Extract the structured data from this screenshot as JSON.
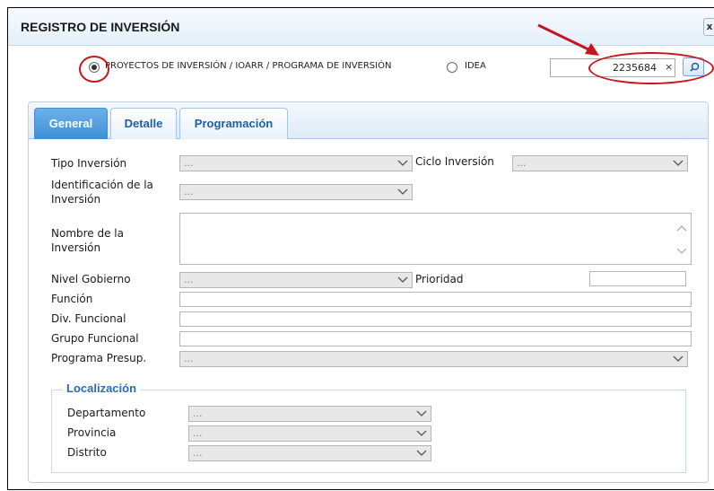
{
  "header": {
    "title": "REGISTRO DE INVERSIÓN"
  },
  "radios": [
    {
      "label": "PROYECTOS DE INVERSIÓN / IOARR / PROGRAMA DE INVERSIÓN",
      "checked": true
    },
    {
      "label": "IDEA",
      "checked": false
    }
  ],
  "search": {
    "value": "2235684",
    "clear": "×"
  },
  "tabs": [
    {
      "label": "General",
      "active": true
    },
    {
      "label": "Detalle",
      "active": false
    },
    {
      "label": "Programación",
      "active": false
    }
  ],
  "form": {
    "tipo_inversion": {
      "label": "Tipo Inversión",
      "value": "..."
    },
    "ciclo_inversion": {
      "label": "Ciclo Inversión",
      "value": "..."
    },
    "identificacion": {
      "label": "Identificación de la Inversión",
      "value": "..."
    },
    "nombre": {
      "label": "Nombre de la Inversión",
      "value": ""
    },
    "nivel_gobierno": {
      "label": "Nivel Gobierno",
      "value": "..."
    },
    "prioridad": {
      "label": "Prioridad",
      "value": ""
    },
    "funcion": {
      "label": "Función",
      "value": ""
    },
    "div_funcional": {
      "label": "Div. Funcional",
      "value": ""
    },
    "grupo_funcional": {
      "label": "Grupo Funcional",
      "value": ""
    },
    "programa_presup": {
      "label": "Programa Presup.",
      "value": "..."
    }
  },
  "localizacion": {
    "legend": "Localización",
    "departamento": {
      "label": "Departamento",
      "value": "..."
    },
    "provincia": {
      "label": "Provincia",
      "value": "..."
    },
    "distrito": {
      "label": "Distrito",
      "value": "..."
    }
  },
  "colors": {
    "accent": "#3d8fd6",
    "annotation": "#c8141e",
    "legend": "#2a6ab0"
  },
  "icons": {
    "search": "magnifier-icon",
    "dropdown": "chevron-down-icon"
  }
}
